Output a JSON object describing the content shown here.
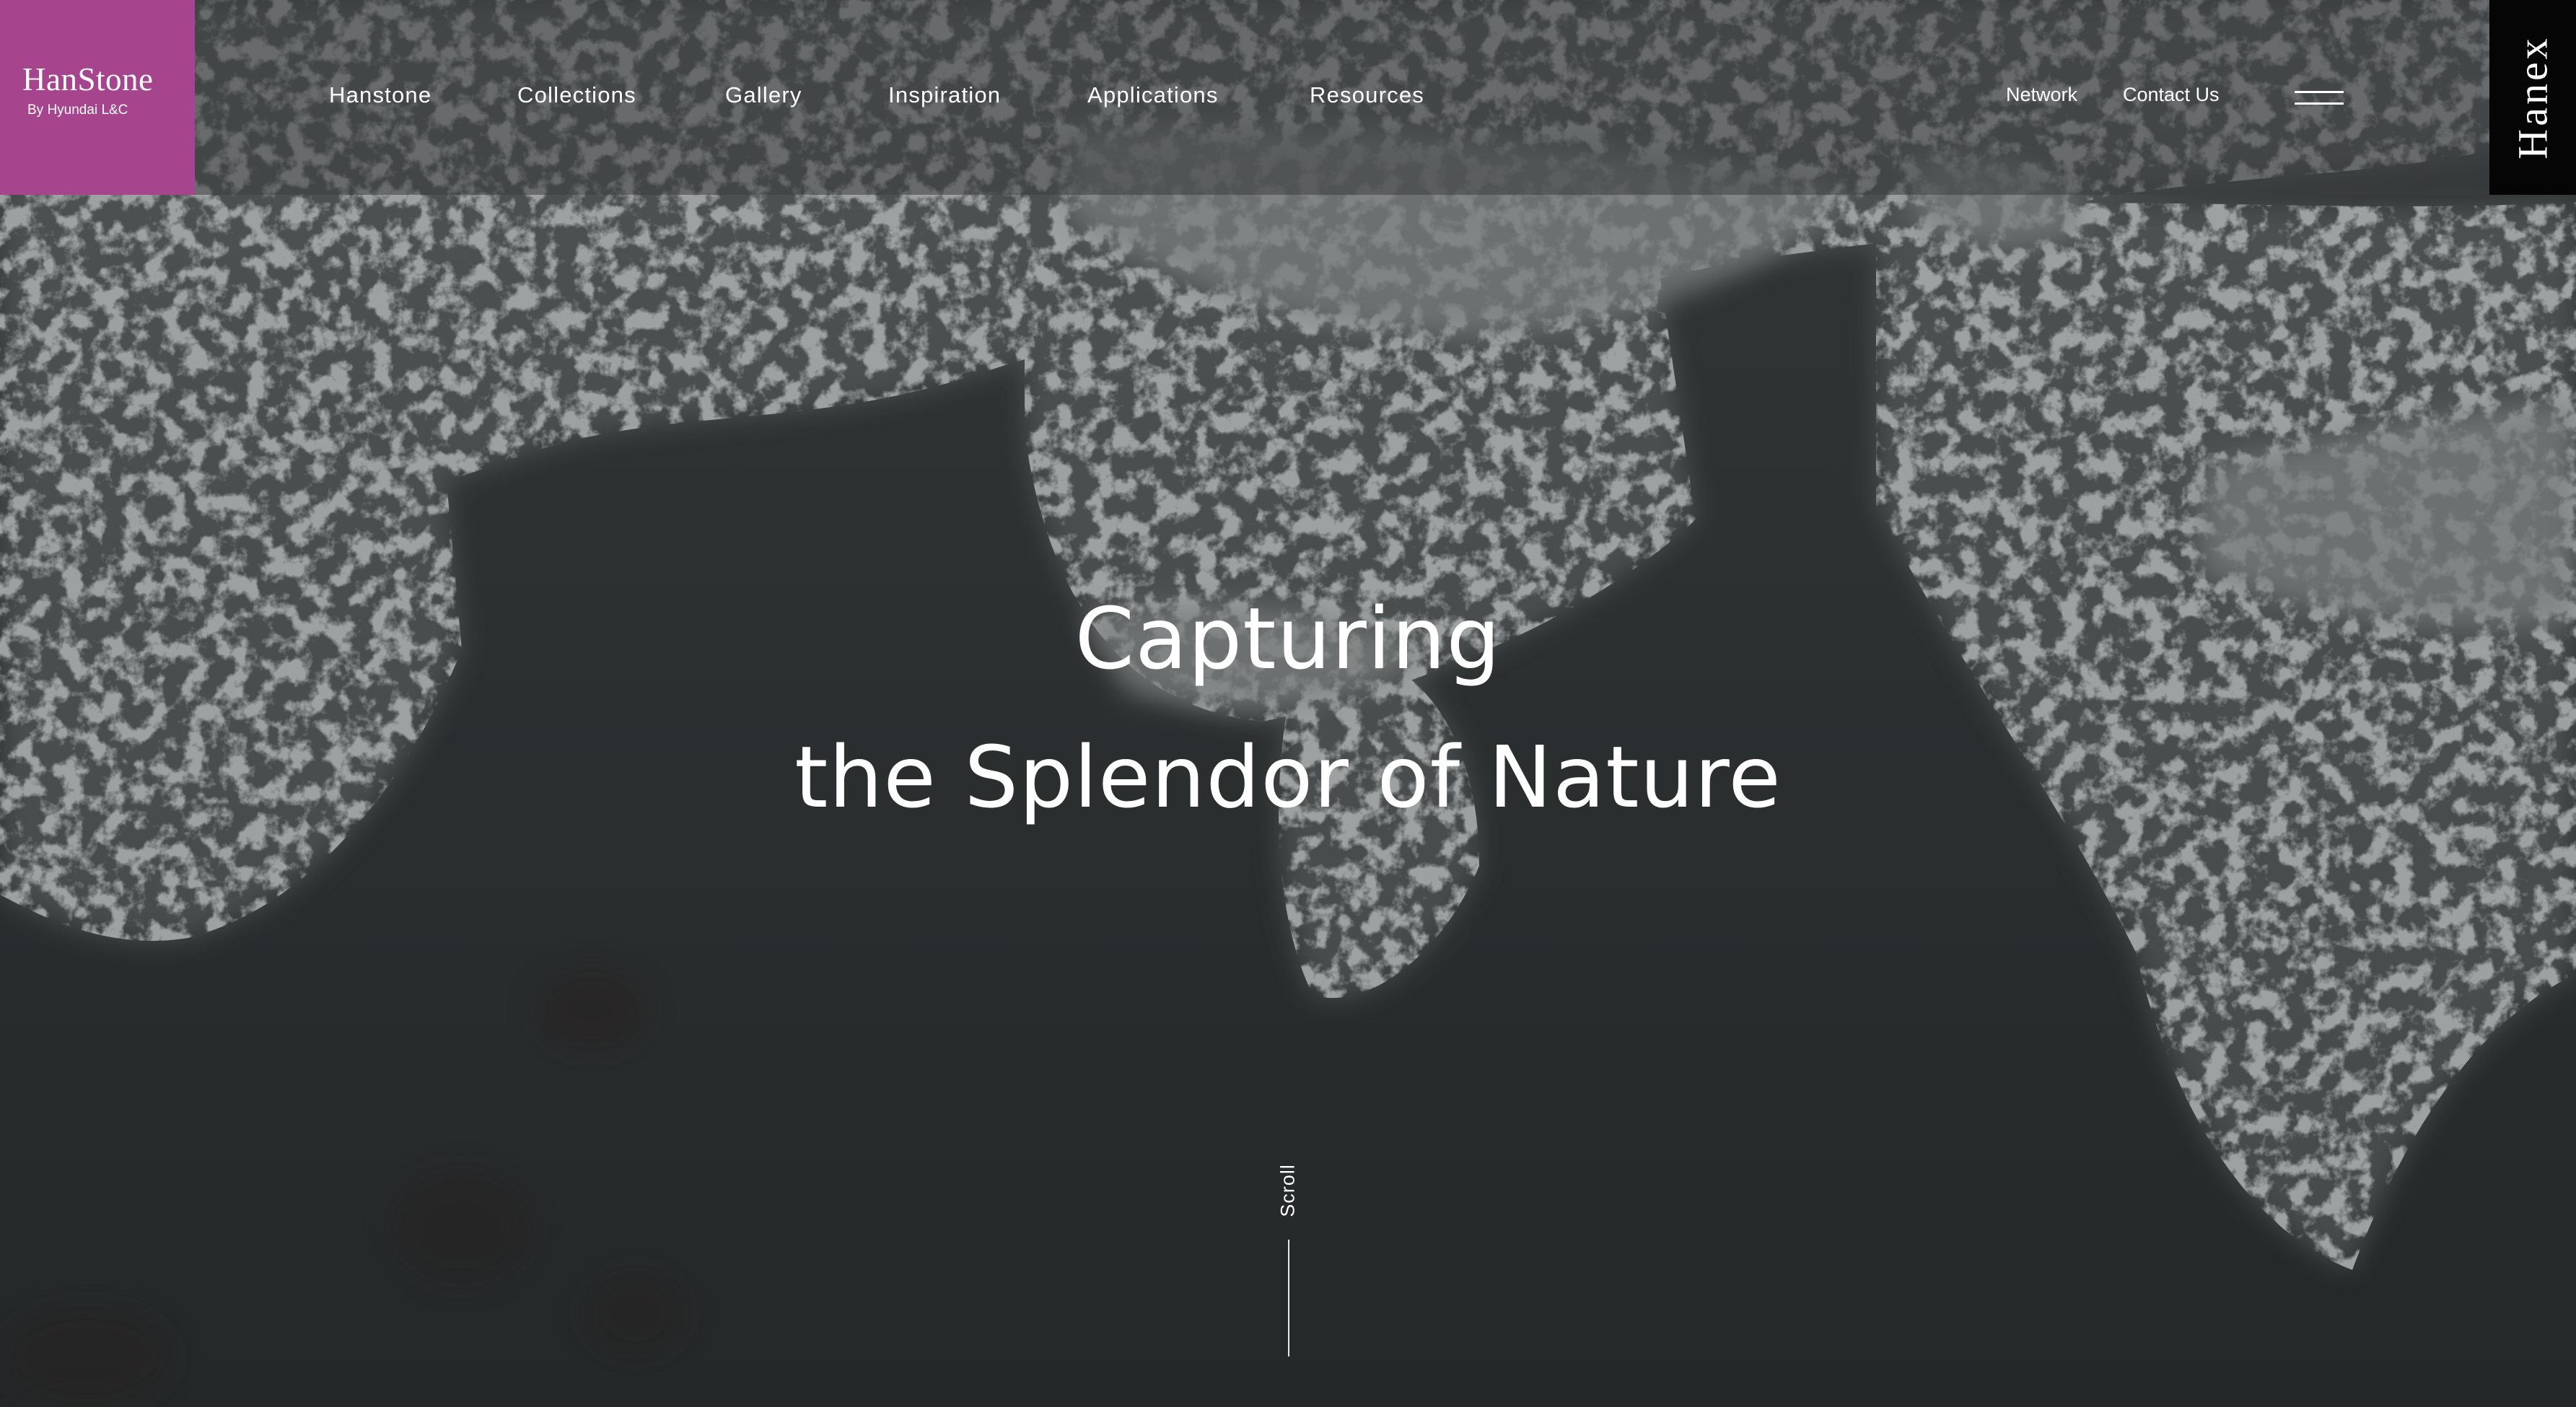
{
  "brand": {
    "name": "HanStone",
    "tagline": "By Hyundai L&C",
    "color": "#a7448e"
  },
  "nav": {
    "items": [
      {
        "label": "Hanstone"
      },
      {
        "label": "Collections"
      },
      {
        "label": "Gallery"
      },
      {
        "label": "Inspiration"
      },
      {
        "label": "Applications"
      },
      {
        "label": "Resources"
      }
    ]
  },
  "utility": {
    "network": "Network",
    "contact": "Contact Us",
    "menu_icon": "hamburger-menu-icon"
  },
  "sister_brand": {
    "label": "Hanex",
    "color": "#050505"
  },
  "hero": {
    "line1": "Capturing",
    "line2": "the Splendor of Nature"
  },
  "scroll": {
    "label": "Scroll"
  }
}
